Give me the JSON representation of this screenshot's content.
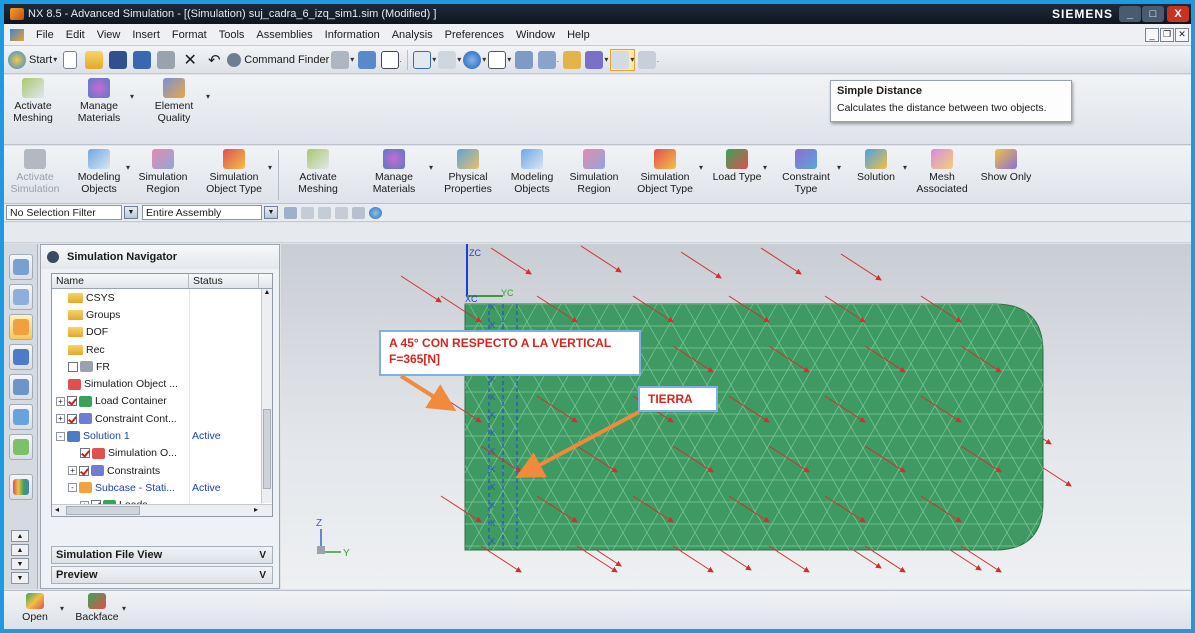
{
  "window": {
    "title": "NX 8.5 - Advanced Simulation - [(Simulation) suj_cadra_6_izq_sim1.sim (Modified) ]",
    "brand": "SIEMENS",
    "controls": [
      "_",
      "□",
      "X"
    ]
  },
  "menubar": {
    "items": [
      "File",
      "Edit",
      "View",
      "Insert",
      "Format",
      "Tools",
      "Assemblies",
      "Information",
      "Analysis",
      "Preferences",
      "Window",
      "Help"
    ]
  },
  "standard_toolbar": {
    "start_label": "Start",
    "command_finder_label": "Command Finder"
  },
  "tooltip": {
    "title": "Simple Distance",
    "description": "Calculates the distance between two objects."
  },
  "ribbon_top": {
    "items": [
      {
        "label": "Activate\nMeshing",
        "icon": "activate-meshing-icon"
      },
      {
        "label": "Manage\nMaterials",
        "icon": "manage-materials-icon"
      },
      {
        "label": "Element\nQuality",
        "icon": "element-quality-icon"
      }
    ]
  },
  "ribbon_main": {
    "items": [
      {
        "label": "Activate\nSimulation",
        "icon": "activate-simulation-icon",
        "disabled": true
      },
      {
        "label": "Modeling\nObjects",
        "icon": "modeling-objects-icon"
      },
      {
        "label": "Simulation\nRegion",
        "icon": "simulation-region-icon"
      },
      {
        "label": "Simulation\nObject Type",
        "icon": "simulation-object-type-icon"
      },
      {
        "label": "Activate\nMeshing",
        "icon": "activate-meshing-icon"
      },
      {
        "label": "Manage\nMaterials",
        "icon": "manage-materials-icon"
      },
      {
        "label": "Physical\nProperties",
        "icon": "physical-properties-icon"
      },
      {
        "label": "Modeling\nObjects",
        "icon": "modeling-objects-icon"
      },
      {
        "label": "Simulation\nRegion",
        "icon": "simulation-region-icon"
      },
      {
        "label": "Simulation\nObject Type",
        "icon": "simulation-object-type-icon"
      },
      {
        "label": "Load Type",
        "icon": "load-type-icon"
      },
      {
        "label": "Constraint\nType",
        "icon": "constraint-type-icon"
      },
      {
        "label": "Solution",
        "icon": "solution-icon"
      },
      {
        "label": "Mesh\nAssociated",
        "icon": "mesh-associated-icon"
      },
      {
        "label": "Show Only",
        "icon": "show-only-icon"
      }
    ]
  },
  "selection_bar": {
    "filter_value": "No Selection Filter",
    "scope_value": "Entire Assembly"
  },
  "navigator": {
    "title": "Simulation Navigator",
    "columns": {
      "name": "Name",
      "status": "Status"
    },
    "rows": [
      {
        "indent": 1,
        "label": "CSYS",
        "status": "",
        "expander": "",
        "check": "",
        "icon": "folder"
      },
      {
        "indent": 1,
        "label": "Groups",
        "status": "",
        "expander": "",
        "check": "",
        "icon": "folder"
      },
      {
        "indent": 1,
        "label": "DOF",
        "status": "",
        "expander": "",
        "check": "",
        "icon": "folder"
      },
      {
        "indent": 1,
        "label": "Rec",
        "status": "",
        "expander": "",
        "check": "",
        "icon": "folder"
      },
      {
        "indent": 1,
        "label": "FR",
        "status": "",
        "expander": "",
        "check": "off",
        "icon": "node"
      },
      {
        "indent": 1,
        "label": "Simulation Object ...",
        "status": "",
        "expander": "",
        "check": "",
        "icon": "sim-object"
      },
      {
        "indent": 0,
        "label": "Load Container",
        "status": "",
        "expander": "+",
        "check": "on",
        "icon": "load"
      },
      {
        "indent": 0,
        "label": "Constraint Cont...",
        "status": "",
        "expander": "+",
        "check": "on",
        "icon": "constraint"
      },
      {
        "indent": 0,
        "label": "Solution 1",
        "status": "Active",
        "expander": "-",
        "check": "",
        "icon": "solution",
        "blue": true
      },
      {
        "indent": 2,
        "label": "Simulation O...",
        "status": "",
        "expander": "",
        "check": "on",
        "icon": "sim-object"
      },
      {
        "indent": 1,
        "label": "Constraints",
        "status": "",
        "expander": "+",
        "check": "on",
        "icon": "constraint"
      },
      {
        "indent": 1,
        "label": "Subcase - Stati...",
        "status": "Active",
        "expander": "-",
        "check": "",
        "icon": "subcase",
        "blue": true
      },
      {
        "indent": 2,
        "label": "Loads",
        "status": "",
        "expander": "+",
        "check": "on",
        "icon": "load"
      }
    ],
    "sections": [
      {
        "label": "Simulation File View",
        "chevron": "V"
      },
      {
        "label": "Preview",
        "chevron": "V"
      }
    ]
  },
  "viewport": {
    "axes": {
      "zc": "ZC",
      "xc": "XC",
      "yc": "YC",
      "z": "Z",
      "y": "Y"
    },
    "callout_force": "A 45° CON RESPECTO A LA VERTICAL\nF=365[N]",
    "callout_ground": "TIERRA",
    "colors": {
      "mesh_fill": "#3e9a62",
      "mesh_line": "#7ec79a",
      "load_arrow": "#d03030",
      "callout_arrow": "#f08a3c",
      "constraint": "#2a4fc8"
    }
  },
  "bottom_bar": {
    "items": [
      {
        "label": "Open",
        "icon": "open-icon"
      },
      {
        "label": "Backface",
        "icon": "backface-icon"
      }
    ]
  }
}
